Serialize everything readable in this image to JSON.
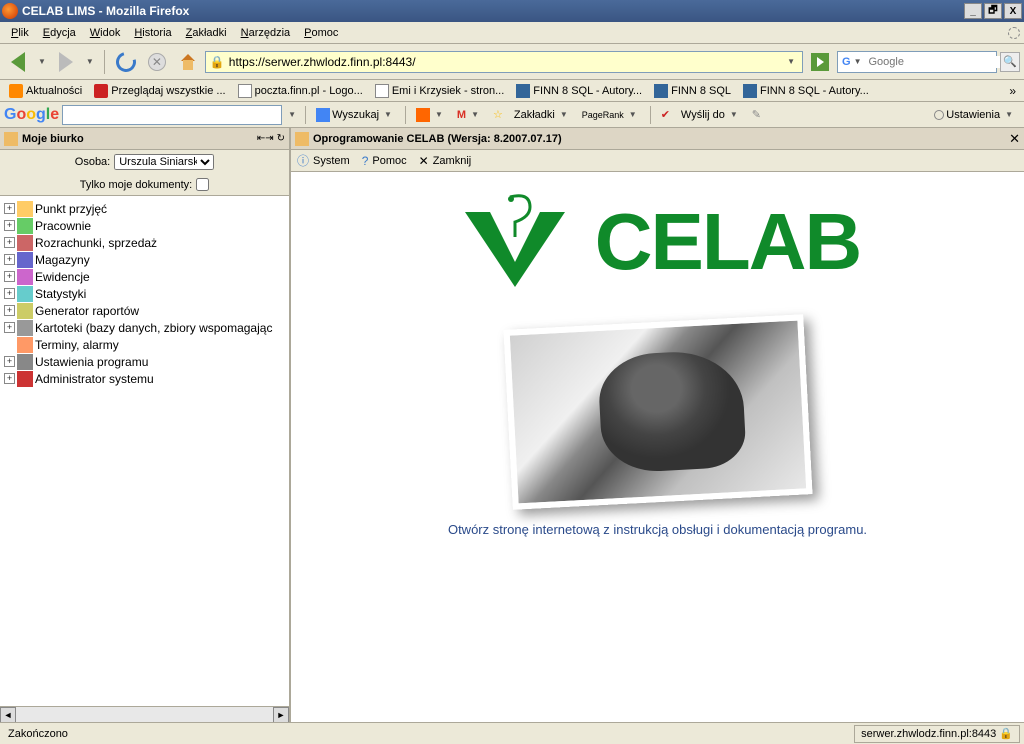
{
  "window": {
    "title": "CELAB LIMS - Mozilla Firefox",
    "buttons": {
      "min": "_",
      "max": "🗗",
      "close": "X"
    }
  },
  "menubar": [
    "Plik",
    "Edycja",
    "Widok",
    "Historia",
    "Zakładki",
    "Narzędzia",
    "Pomoc"
  ],
  "url": "https://serwer.zhwlodz.finn.pl:8443/",
  "search_placeholder": "Google",
  "bookmarks": [
    {
      "icon": "rss",
      "label": "Aktualności"
    },
    {
      "icon": "finn",
      "label": "Przeglądaj wszystkie ..."
    },
    {
      "icon": "page",
      "label": "poczta.finn.pl - Logo..."
    },
    {
      "icon": "page",
      "label": "Emi i Krzysiek - stron..."
    },
    {
      "icon": "blue",
      "label": "FINN 8 SQL - Autory..."
    },
    {
      "icon": "blue",
      "label": "FINN 8 SQL"
    },
    {
      "icon": "blue",
      "label": "FINN 8 SQL - Autory..."
    }
  ],
  "bookmarks_more": "»",
  "googlebar": {
    "search_btn": "Wyszukaj",
    "bookmarks_btn": "Zakładki",
    "pagerank": "PageRank",
    "send_btn": "Wyślij do",
    "settings": "Ustawienia"
  },
  "sidebar": {
    "title": "Moje biurko",
    "person_label": "Osoba:",
    "person_value": "Urszula Siniarska",
    "mydocs_label": "Tylko moje dokumenty:",
    "tree": [
      "Punkt przyjęć",
      "Pracownie",
      "Rozrachunki, sprzedaż",
      "Magazyny",
      "Ewidencje",
      "Statystyki",
      "Generator raportów",
      "Kartoteki (bazy danych, zbiory wspomagając",
      "Terminy, alarmy",
      "Ustawienia programu",
      "Administrator systemu"
    ]
  },
  "content": {
    "header": "Oprogramowanie CELAB (Wersja: 8.2007.07.17)",
    "menu": {
      "system": "System",
      "help": "Pomoc",
      "close": "Zamknij"
    },
    "logo_text": "CELAB",
    "doc_link": "Otwórz stronę internetową z instrukcją obsługi i dokumentacją programu."
  },
  "statusbar": {
    "left": "Zakończono",
    "right": "serwer.zhwlodz.finn.pl:8443"
  }
}
